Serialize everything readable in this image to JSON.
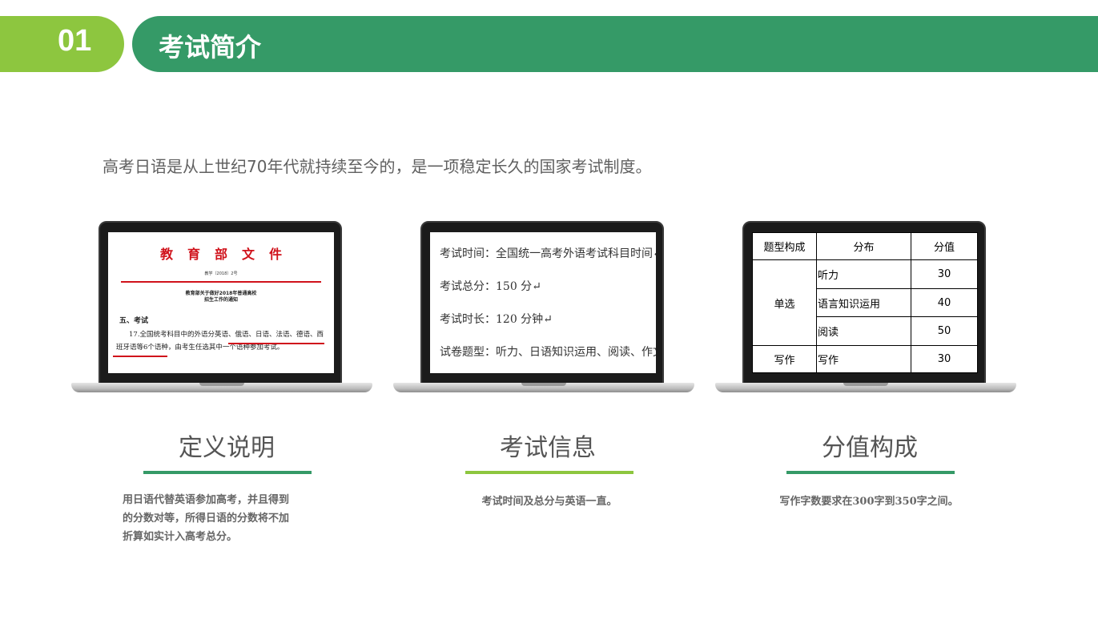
{
  "header": {
    "number": "01",
    "title": "考试简介"
  },
  "intro": "高考日语是从上世纪70年代就持续至今的，是一项稳定长久的国家考试制度。",
  "colors": {
    "green": "#359a67",
    "light_green": "#8dc63f",
    "red": "#d0121b"
  },
  "laptop1": {
    "doc_head": "教育部文件",
    "doc_number": "教学〔2018〕2号",
    "doc_subtitle_1": "教育部关于做好2018年普通高校",
    "doc_subtitle_2": "招生工作的通知",
    "section": "五、考试",
    "body": "17.全国统考科目中的外语分英语、俄语、日语、法语、德语、西班牙语等6个语种，由考生任选其中一个语种参加考试。"
  },
  "laptop2": {
    "lines": [
      "考试时间：全国统一高考外语考试科目时间↵",
      "考试总分：150 分↵",
      "考试时长：120 分钟↵",
      "试卷题型：听力、日语知识运用、阅读、作文。"
    ]
  },
  "laptop3": {
    "headers": [
      "题型构成",
      "分布",
      "分值"
    ],
    "group1": "单选",
    "rows1": [
      {
        "item": "听力",
        "score": "30"
      },
      {
        "item": "语言知识运用",
        "score": "40"
      },
      {
        "item": "阅读",
        "score": "50"
      }
    ],
    "group2": "写作",
    "row2": {
      "item": "写作",
      "score": "30"
    }
  },
  "captions": [
    {
      "title": "定义说明",
      "text_lines": [
        "用日语代替英语参加高考，并且得到",
        "的分数对等，所得日语的分数将不加",
        "折算如实计入高考总分。"
      ]
    },
    {
      "title": "考试信息",
      "text_lines": [
        "考试时间及总分与英语一直。"
      ]
    },
    {
      "title": "分值构成",
      "text_lines": [
        "写作字数要求在300字到350字之间。"
      ]
    }
  ]
}
